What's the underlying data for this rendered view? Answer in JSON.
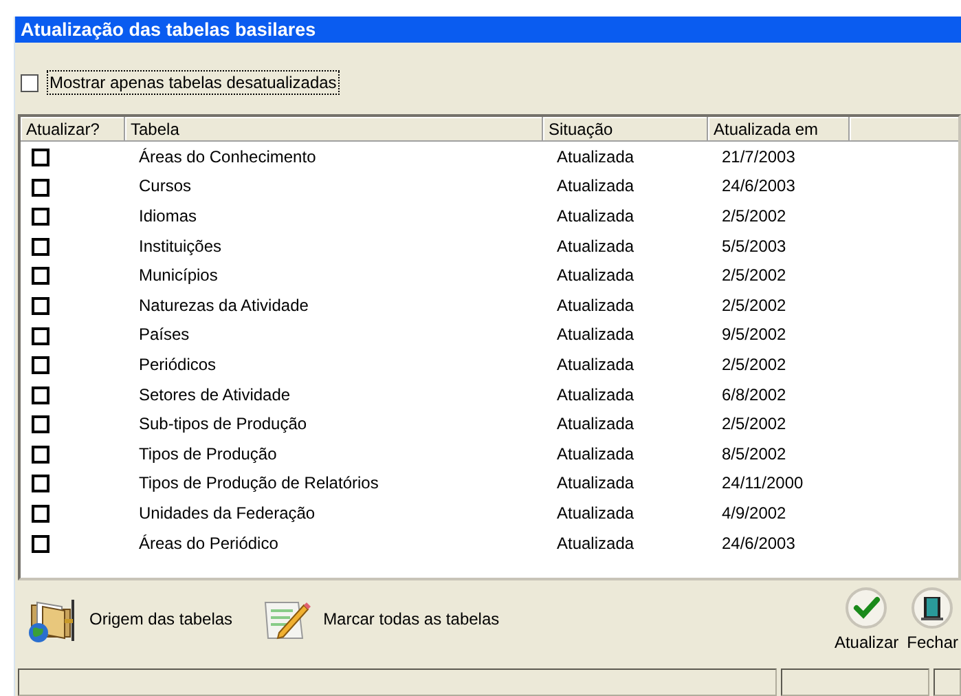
{
  "window": {
    "title": "Atualização das tabelas basilares"
  },
  "filter": {
    "label": "Mostrar apenas tabelas desatualizadas",
    "checked": false
  },
  "table": {
    "columns": [
      "Atualizar?",
      "Tabela",
      "Situação",
      "Atualizada em"
    ],
    "rows": [
      {
        "checked": false,
        "tabela": "Áreas do Conhecimento",
        "situacao": "Atualizada",
        "data": "21/7/2003"
      },
      {
        "checked": false,
        "tabela": "Cursos",
        "situacao": "Atualizada",
        "data": "24/6/2003"
      },
      {
        "checked": false,
        "tabela": "Idiomas",
        "situacao": "Atualizada",
        "data": "2/5/2002"
      },
      {
        "checked": false,
        "tabela": "Instituições",
        "situacao": "Atualizada",
        "data": "5/5/2003"
      },
      {
        "checked": false,
        "tabela": "Municípios",
        "situacao": "Atualizada",
        "data": "2/5/2002"
      },
      {
        "checked": false,
        "tabela": "Naturezas da Atividade",
        "situacao": "Atualizada",
        "data": "2/5/2002"
      },
      {
        "checked": false,
        "tabela": "Países",
        "situacao": "Atualizada",
        "data": "9/5/2002"
      },
      {
        "checked": false,
        "tabela": "Periódicos",
        "situacao": "Atualizada",
        "data": "2/5/2002"
      },
      {
        "checked": false,
        "tabela": "Setores de Atividade",
        "situacao": "Atualizada",
        "data": "6/8/2002"
      },
      {
        "checked": false,
        "tabela": "Sub-tipos de Produção",
        "situacao": "Atualizada",
        "data": "2/5/2002"
      },
      {
        "checked": false,
        "tabela": "Tipos de Produção",
        "situacao": "Atualizada",
        "data": "8/5/2002"
      },
      {
        "checked": false,
        "tabela": "Tipos de Produção de Relatórios",
        "situacao": "Atualizada",
        "data": "24/11/2000"
      },
      {
        "checked": false,
        "tabela": "Unidades da Federação",
        "situacao": "Atualizada",
        "data": "4/9/2002"
      },
      {
        "checked": false,
        "tabela": "Áreas do Periódico",
        "situacao": "Atualizada",
        "data": "24/6/2003"
      }
    ]
  },
  "toolbar": [
    {
      "kind": "origin",
      "label": "Origem das tabelas"
    },
    {
      "kind": "markall",
      "label": "Marcar todas as tabelas"
    }
  ],
  "actions": [
    {
      "kind": "update",
      "label": "Atualizar"
    },
    {
      "kind": "close",
      "label": "Fechar"
    }
  ]
}
